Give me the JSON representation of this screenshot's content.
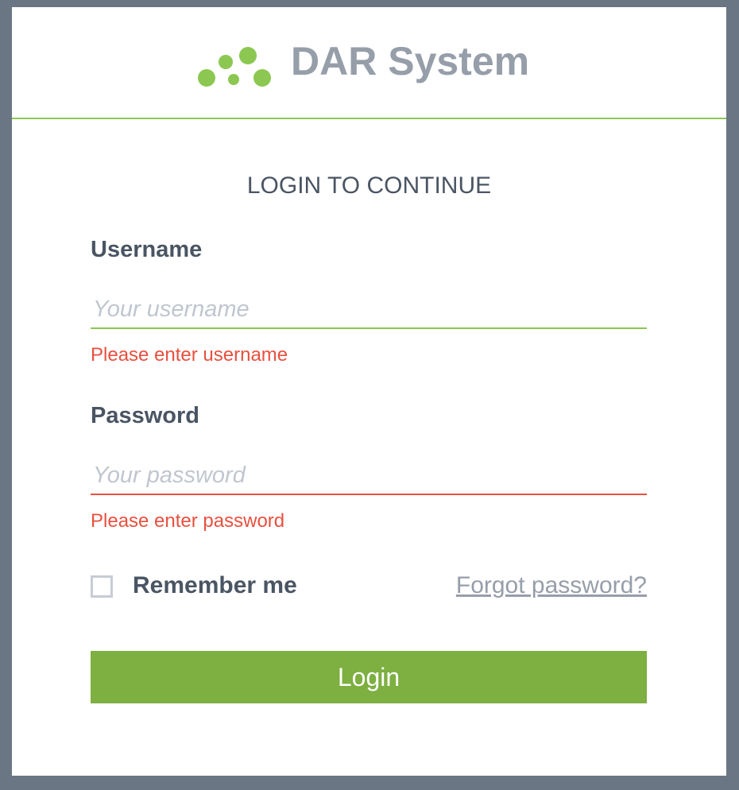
{
  "brand": {
    "name": "DAR System",
    "logo_icon": "dots-logo-icon",
    "accent_color": "#8cc751"
  },
  "login": {
    "title": "LOGIN TO CONTINUE",
    "username": {
      "label": "Username",
      "placeholder": "Your username",
      "value": "",
      "error": "Please enter username"
    },
    "password": {
      "label": "Password",
      "placeholder": "Your password",
      "value": "",
      "error": "Please enter password"
    },
    "remember_me": {
      "label": "Remember me",
      "checked": false
    },
    "forgot_password": "Forgot password?",
    "submit_label": "Login",
    "submit_color": "#7daf41",
    "error_color": "#e8503f"
  }
}
